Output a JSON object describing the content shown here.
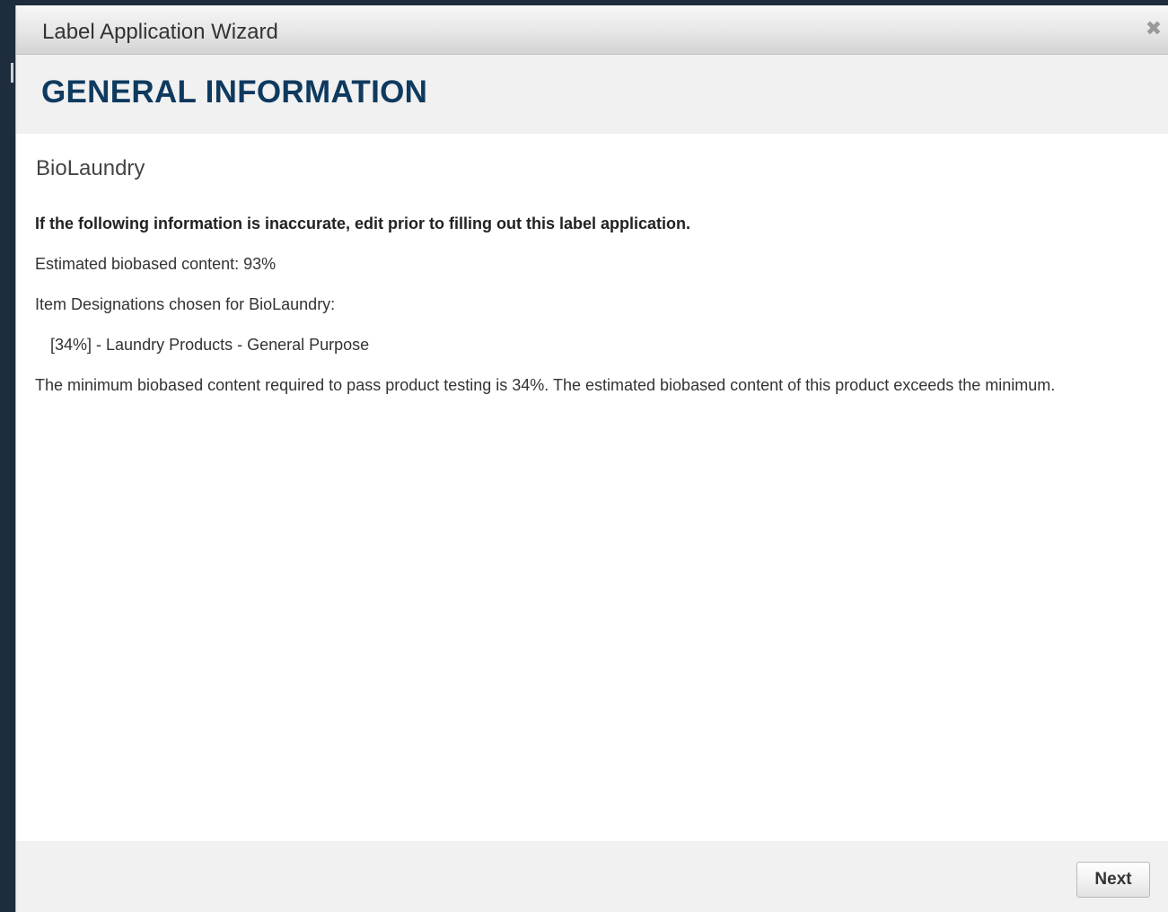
{
  "dialog": {
    "title": "Label Application Wizard",
    "close_icon": "close-icon",
    "close_glyph": "✖"
  },
  "wizard": {
    "step_title": "GENERAL INFORMATION"
  },
  "body": {
    "product_name": "BioLaundry",
    "notice": "If the following information is inaccurate, edit prior to filling out this label application.",
    "estimated_content": "Estimated biobased content: 93%",
    "designations_heading": "Item Designations chosen for BioLaundry:",
    "designations": [
      "[34%] - Laundry Products - General Purpose"
    ],
    "minimum_text": "The minimum biobased content required to pass product testing is 34%. The estimated biobased content of this product exceeds the minimum."
  },
  "footer": {
    "next_label": "Next"
  },
  "colors": {
    "step_title": "#0f3a5f",
    "header_bg": "#f1f1f1",
    "backdrop": "#1e2d3d"
  }
}
